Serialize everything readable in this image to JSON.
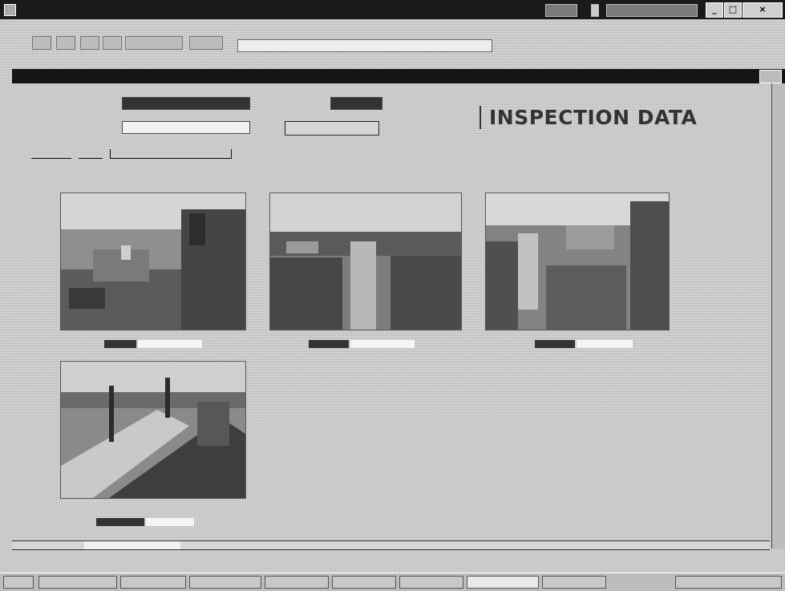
{
  "inspection_heading": "INSPECTION DATA"
}
